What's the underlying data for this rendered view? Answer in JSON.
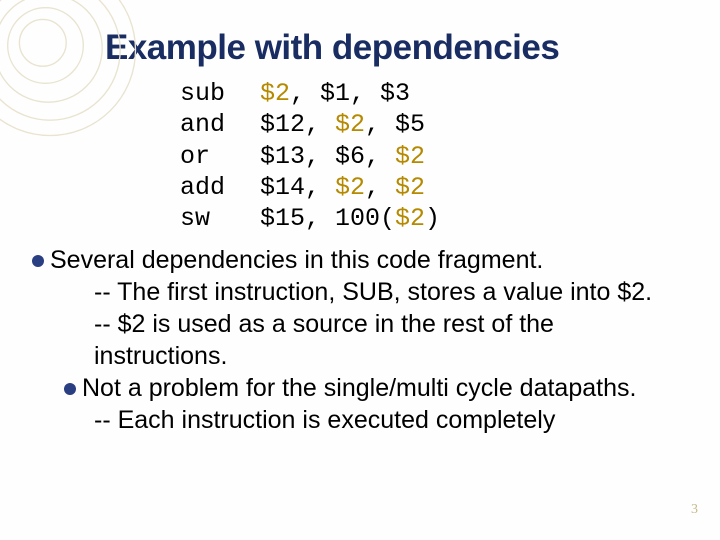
{
  "title": "Example with dependencies",
  "code": {
    "ops": [
      "sub",
      "and",
      "or",
      "add",
      "sw"
    ],
    "args": {
      "l1": {
        "a": "$2",
        "b": ", $1, $3"
      },
      "l2": {
        "a": "$12, ",
        "b": "$2",
        "c": ", $5"
      },
      "l3": {
        "a": "$13, $6, ",
        "b": "$2"
      },
      "l4": {
        "a": "$14, ",
        "b": "$2",
        "c": ", ",
        "d": "$2"
      },
      "l5": {
        "a": "$15, 100(",
        "b": "$2",
        "c": ")"
      }
    }
  },
  "body": {
    "b1": "Several dependencies in this code fragment.",
    "d1": "-- The first instruction, SUB, stores a value into $2.",
    "d2": "-- $2 is used as a source in the rest of the instructions.",
    "b2": "Not a problem for the single/multi cycle datapaths.",
    "d3": "-- Each instruction is executed completely"
  },
  "page": "3"
}
